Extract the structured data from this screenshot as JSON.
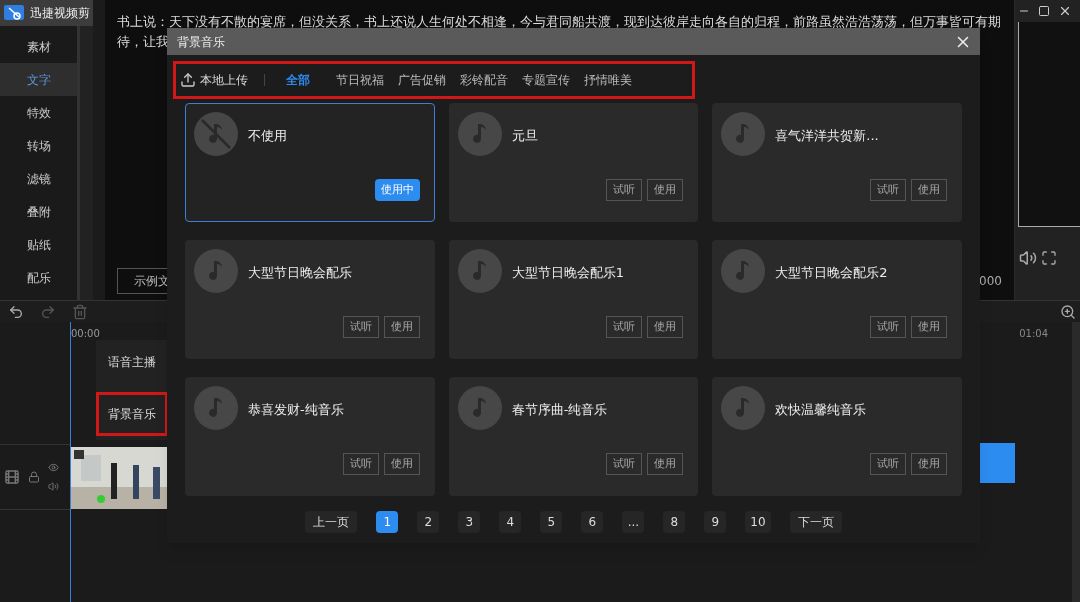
{
  "app": {
    "title": "迅捷视频剪"
  },
  "sidebar": {
    "items": [
      {
        "label": "素材",
        "selected": false
      },
      {
        "label": "文字",
        "selected": true
      },
      {
        "label": "特效",
        "selected": false
      },
      {
        "label": "转场",
        "selected": false
      },
      {
        "label": "滤镜",
        "selected": false
      },
      {
        "label": "叠附",
        "selected": false
      },
      {
        "label": "贴纸",
        "selected": false
      },
      {
        "label": "配乐",
        "selected": false
      }
    ]
  },
  "preview": {
    "caption_lines": [
      "书上说：天下没有不散的宴席，但没关系，书上还说人生何处不相逢，今与君同船共渡，现到达彼岸走向各自的归程，前路虽然浩浩荡荡，但万事皆可有期",
      "待，让我"
    ],
    "sample_button": "示例文",
    "counter": "000"
  },
  "timeline": {
    "start_time": "00:00",
    "end_time": "01:04"
  },
  "audio_menu": {
    "items": [
      {
        "label": "语音主播",
        "highlighted": false
      },
      {
        "label": "背景音乐",
        "highlighted": true
      }
    ]
  },
  "dialog": {
    "title": "背景音乐",
    "toolbar_highlighted": true,
    "upload": "本地上传",
    "categories": [
      {
        "label": "全部",
        "selected": true
      },
      {
        "label": "节日祝福",
        "selected": false
      },
      {
        "label": "广告促销",
        "selected": false
      },
      {
        "label": "彩铃配音",
        "selected": false
      },
      {
        "label": "专题宣传",
        "selected": false
      },
      {
        "label": "抒情唯美",
        "selected": false
      }
    ],
    "tracks": [
      {
        "title": "不使用",
        "kind": "none",
        "in_use": true,
        "buttons": [
          "使用中"
        ]
      },
      {
        "title": "元旦",
        "kind": "music",
        "in_use": false,
        "buttons": [
          "试听",
          "使用"
        ]
      },
      {
        "title": "喜气洋洋共贺新...",
        "kind": "music",
        "in_use": false,
        "buttons": [
          "试听",
          "使用"
        ]
      },
      {
        "title": "大型节日晚会配乐",
        "kind": "music",
        "in_use": false,
        "buttons": [
          "试听",
          "使用"
        ]
      },
      {
        "title": "大型节日晚会配乐1",
        "kind": "music",
        "in_use": false,
        "buttons": [
          "试听",
          "使用"
        ]
      },
      {
        "title": "大型节日晚会配乐2",
        "kind": "music",
        "in_use": false,
        "buttons": [
          "试听",
          "使用"
        ]
      },
      {
        "title": "恭喜发财-纯音乐",
        "kind": "music",
        "in_use": false,
        "buttons": [
          "试听",
          "使用"
        ]
      },
      {
        "title": "春节序曲-纯音乐",
        "kind": "music",
        "in_use": false,
        "buttons": [
          "试听",
          "使用"
        ]
      },
      {
        "title": "欢快温馨纯音乐",
        "kind": "music",
        "in_use": false,
        "buttons": [
          "试听",
          "使用"
        ]
      }
    ],
    "pagination": {
      "prev": "上一页",
      "pages": [
        {
          "label": "1",
          "selected": true
        },
        {
          "label": "2",
          "selected": false
        },
        {
          "label": "3",
          "selected": false
        },
        {
          "label": "4",
          "selected": false
        },
        {
          "label": "5",
          "selected": false
        },
        {
          "label": "6",
          "selected": false
        },
        {
          "label": "...",
          "selected": false
        },
        {
          "label": "8",
          "selected": false
        },
        {
          "label": "9",
          "selected": false
        },
        {
          "label": "10",
          "selected": false
        }
      ],
      "next": "下一页"
    }
  }
}
